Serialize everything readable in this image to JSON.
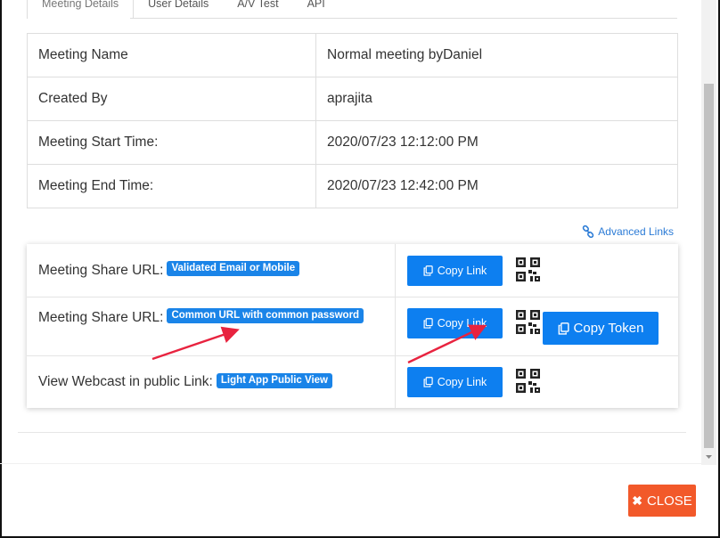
{
  "tabs": [
    {
      "label": "Meeting Details"
    },
    {
      "label": "User Details"
    },
    {
      "label": "A/V Test"
    },
    {
      "label": "API"
    }
  ],
  "details": [
    {
      "key": "Meeting Name",
      "value": "Normal meeting byDaniel"
    },
    {
      "key": "Created By",
      "value": "aprajita"
    },
    {
      "key": "Meeting Start Time:",
      "value": "2020/07/23 12:12:00 PM"
    },
    {
      "key": "Meeting End Time:",
      "value": "2020/07/23 12:42:00 PM"
    }
  ],
  "advanced_links": "Advanced Links",
  "share_rows": [
    {
      "label": "Meeting Share URL:",
      "badge": "Validated Email or Mobile",
      "copy_label": "Copy Link"
    },
    {
      "label": "Meeting Share URL:",
      "badge": "Common URL with common password",
      "copy_label": "Copy Link"
    },
    {
      "label": "View Webcast in public Link:",
      "badge": "Light App Public View",
      "copy_label": "Copy Link"
    }
  ],
  "copy_token": "Copy Token",
  "close_label": "CLOSE",
  "colors": {
    "primary": "#0d7ff0",
    "badge": "#1a84e8",
    "close": "#f2592a",
    "arrow": "#e8233f",
    "link": "#2b7bd6"
  }
}
